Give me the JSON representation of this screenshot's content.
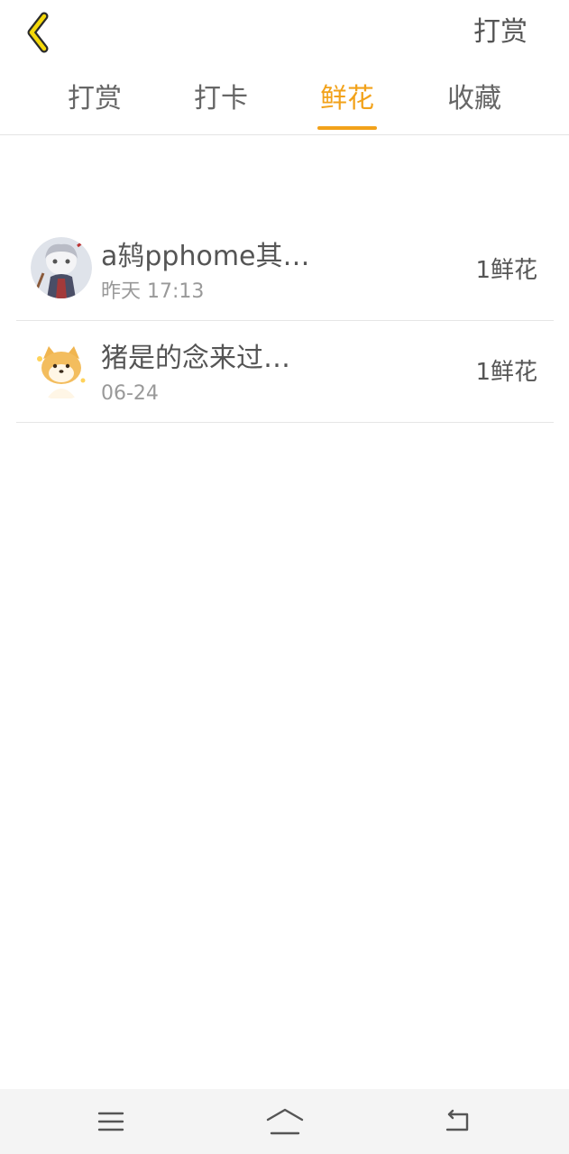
{
  "header": {
    "back_icon": "chevron-left-icon",
    "action_label": "打赏",
    "accent_color": "#f2a21a"
  },
  "tabs": [
    {
      "label": "打赏",
      "active": false
    },
    {
      "label": "打卡",
      "active": false
    },
    {
      "label": "鲜花",
      "active": true
    },
    {
      "label": "收藏",
      "active": false
    }
  ],
  "records": [
    {
      "name": "a鸫pphome其…",
      "time": "昨天 17:13",
      "amount": "1鲜花",
      "avatar": "anime-character-avatar"
    },
    {
      "name": "猪是的念来过…",
      "time": "06-24",
      "amount": "1鲜花",
      "avatar": "shiba-dog-avatar"
    }
  ],
  "navbar": {
    "menu_icon": "menu-icon",
    "home_icon": "home-icon",
    "back_icon": "back-icon"
  }
}
